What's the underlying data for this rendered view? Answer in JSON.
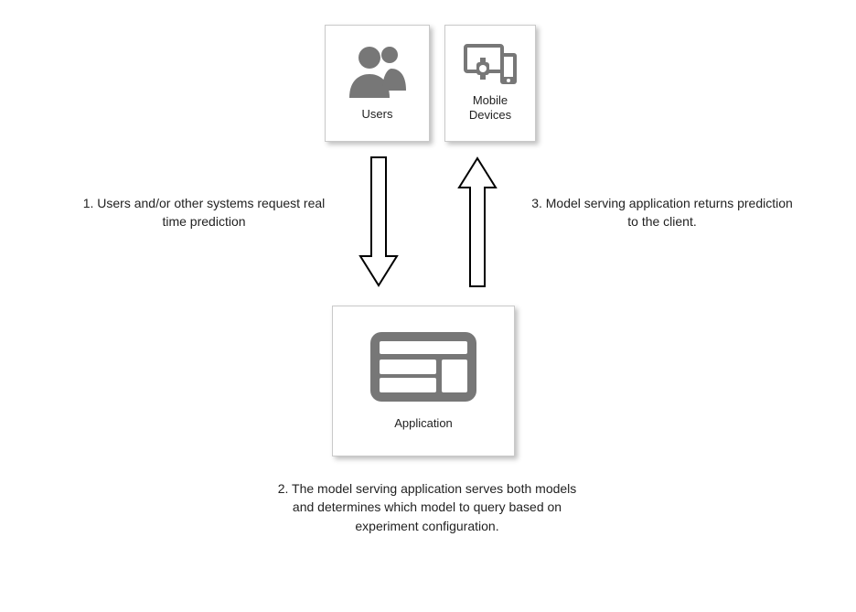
{
  "boxes": {
    "users": {
      "label": "Users"
    },
    "mobile": {
      "label": "Mobile\nDevices"
    },
    "application": {
      "label": "Application"
    }
  },
  "captions": {
    "left": "1. Users and/or other systems request real time prediction",
    "right": "3. Model serving application returns prediction to the client.",
    "bottom": "2. The model serving application serves both models and determines which model to query based on experiment configuration."
  },
  "icons": {
    "users": "users-icon",
    "mobile": "mobile-devices-icon",
    "application": "application-icon"
  },
  "colors": {
    "iconFill": "#777777",
    "border": "#c9c9c9",
    "text": "#222222",
    "arrowStroke": "#000000"
  }
}
